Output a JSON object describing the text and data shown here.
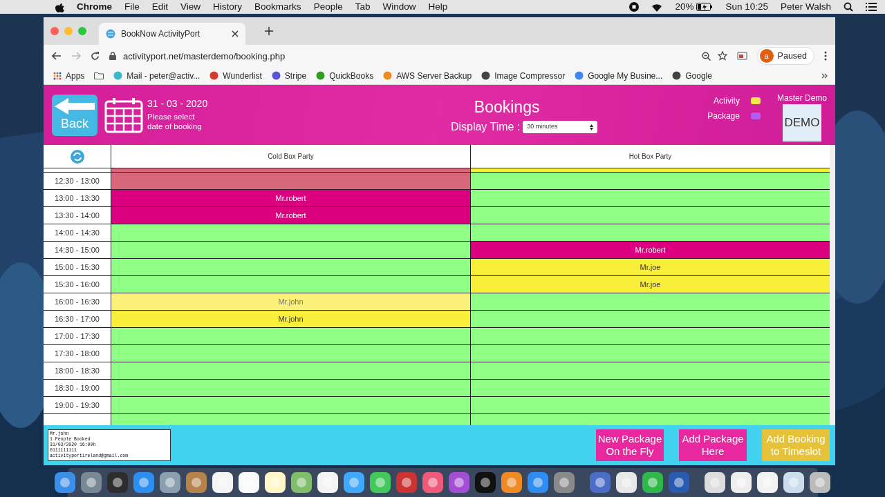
{
  "menu_bar": {
    "app": "Chrome",
    "menus": [
      "File",
      "Edit",
      "View",
      "History",
      "Bookmarks",
      "People",
      "Tab",
      "Window",
      "Help"
    ],
    "battery": "20%",
    "clock": "Sun 10:25",
    "user": "Peter Walsh"
  },
  "browser": {
    "tab_title": "BookNow ActivityPort",
    "url": "activityport.net/masterdemo/booking.php",
    "profile_initial": "a",
    "profile_status": "Paused",
    "bookmarks": [
      {
        "kind": "apps",
        "label": "Apps"
      },
      {
        "kind": "folder"
      },
      {
        "kind": "web",
        "label": "Mail - peter@activ...",
        "color": "#3bb8c8"
      },
      {
        "kind": "web",
        "label": "Wunderlist",
        "color": "#d63a2f"
      },
      {
        "kind": "web",
        "label": "Stripe",
        "color": "#5b54d6"
      },
      {
        "kind": "web",
        "label": "QuickBooks",
        "color": "#2ca01c"
      },
      {
        "kind": "web",
        "label": "AWS Server Backup",
        "color": "#f08a1c"
      },
      {
        "kind": "web",
        "label": "Image Compressor",
        "color": "#444444"
      },
      {
        "kind": "web",
        "label": "Google My Busine...",
        "color": "#4285f4"
      },
      {
        "kind": "web",
        "label": "Google",
        "color": "#444444"
      }
    ]
  },
  "page": {
    "back": "Back",
    "date": "31 - 03 - 2020",
    "date_hint": "Please select date of booking",
    "title": "Bookings",
    "display_time_label": "Display Time :",
    "display_time_value": "30 minutes",
    "legend": [
      {
        "label": "Activity",
        "color": "#f3e84a"
      },
      {
        "label": "Package",
        "color": "#b25cf0"
      }
    ],
    "account": "Master Demo",
    "logo_text": "DEMO",
    "columns": [
      "Cold Box Party",
      "Hot Box Party"
    ],
    "rows": [
      {
        "cells": [
          {
            "color": "#d9687c"
          },
          {
            "color": "#f9ef3a"
          }
        ]
      },
      {
        "time": "12:30 - 13:00",
        "cells": [
          {
            "color": "#d9687c"
          },
          {
            "color": "#8fff85"
          }
        ]
      },
      {
        "time": "13:00 - 13:30",
        "cells": [
          {
            "color": "#dc0080",
            "text": "Mr.robert"
          },
          {
            "color": "#8fff85"
          }
        ]
      },
      {
        "time": "13:30 - 14:00",
        "cells": [
          {
            "color": "#dc0080",
            "text": "Mr.robert"
          },
          {
            "color": "#8fff85"
          }
        ]
      },
      {
        "time": "14:00 - 14:30",
        "cells": [
          {
            "color": "#8fff85"
          },
          {
            "color": "#8fff85"
          }
        ]
      },
      {
        "time": "14:30 - 15:00",
        "cells": [
          {
            "color": "#8fff85"
          },
          {
            "color": "#dc0080",
            "text": "Mr.robert"
          }
        ]
      },
      {
        "time": "15:00 - 15:30",
        "cells": [
          {
            "color": "#8fff85"
          },
          {
            "color": "#f9ef3a",
            "text": "Mr.joe"
          }
        ]
      },
      {
        "time": "15:30 - 16:00",
        "cells": [
          {
            "color": "#8fff85"
          },
          {
            "color": "#f9ef3a",
            "text": "Mr.joe"
          }
        ]
      },
      {
        "time": "16:00 - 16:30",
        "cells": [
          {
            "color": "#faf07a",
            "text": "Mr.john"
          },
          {
            "color": "#8fff85"
          }
        ]
      },
      {
        "time": "16:30 - 17:00",
        "cells": [
          {
            "color": "#f9ef3a",
            "text": "Mr.john"
          },
          {
            "color": "#8fff85"
          }
        ]
      },
      {
        "time": "17:00 - 17:30",
        "cells": [
          {
            "color": "#8fff85"
          },
          {
            "color": "#8fff85"
          }
        ]
      },
      {
        "time": "17:30 - 18:00",
        "cells": [
          {
            "color": "#8fff85"
          },
          {
            "color": "#8fff85"
          }
        ]
      },
      {
        "time": "18:00 - 18:30",
        "cells": [
          {
            "color": "#8fff85"
          },
          {
            "color": "#8fff85"
          }
        ]
      },
      {
        "time": "18:30 - 19:00",
        "cells": [
          {
            "color": "#8fff85"
          },
          {
            "color": "#8fff85"
          }
        ]
      },
      {
        "time": "19:00 - 19:30",
        "cells": [
          {
            "color": "#8fff85"
          },
          {
            "color": "#8fff85"
          }
        ]
      },
      {
        "cells": [
          {
            "color": "#8fff85"
          },
          {
            "color": "#8fff85"
          }
        ]
      }
    ],
    "details": [
      "Mr.john",
      "1 People Booked",
      "31/03/2020 16:00h",
      "0111111111",
      "activityportireland@gmail.com"
    ],
    "buttons": [
      {
        "lines": [
          "New Package",
          "On the Fly"
        ],
        "color": "#e8289f"
      },
      {
        "lines": [
          "Add Package",
          "Here"
        ],
        "color": "#e8289f"
      },
      {
        "lines": [
          "Add Booking",
          "to Timeslot"
        ],
        "color": "#e6c23a"
      }
    ]
  }
}
